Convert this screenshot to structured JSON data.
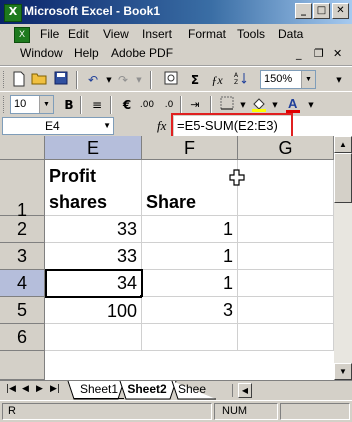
{
  "window": {
    "title": "Microsoft Excel - Book1",
    "buttons": {
      "minimize": "_",
      "maximize": "□",
      "close": "✕"
    }
  },
  "menu": {
    "row1": [
      "File",
      "Edit",
      "View",
      "Insert",
      "Format",
      "Tools",
      "Data"
    ],
    "row2": [
      "Window",
      "Help",
      "Adobe PDF"
    ],
    "mdi": {
      "minimize": "_",
      "restore": "❐",
      "close": "✕"
    }
  },
  "toolbar1": {
    "zoom": "150%"
  },
  "toolbar2": {
    "font_size": "10"
  },
  "formula_bar": {
    "name_box": "E4",
    "fx": "fx",
    "formula": "=E5-SUM(E2:E3)"
  },
  "grid": {
    "columns": [
      "E",
      "F",
      "G"
    ],
    "selected_column": "E",
    "rows": [
      "1",
      "2",
      "3",
      "4",
      "5",
      "6"
    ],
    "selected_row": "4",
    "cells": {
      "E1": "Profit shares",
      "E1a": "Profit",
      "E1b": "shares",
      "F1": "Share",
      "E2": "33",
      "F2": "1",
      "E3": "33",
      "F3": "1",
      "E4": "34",
      "F4": "1",
      "E5": "100",
      "F5": "3"
    }
  },
  "sheet_tabs": {
    "tabs": [
      "Sheet1",
      "Sheet2",
      "Shee"
    ],
    "active": "Sheet2"
  },
  "status_bar": {
    "ready": "R",
    "num": "NUM"
  },
  "colors": {
    "title_bar": "#0a246a",
    "selected_header": "#b5bedb",
    "highlight_box": "#e02020",
    "font_color_bar": "#e00000"
  }
}
